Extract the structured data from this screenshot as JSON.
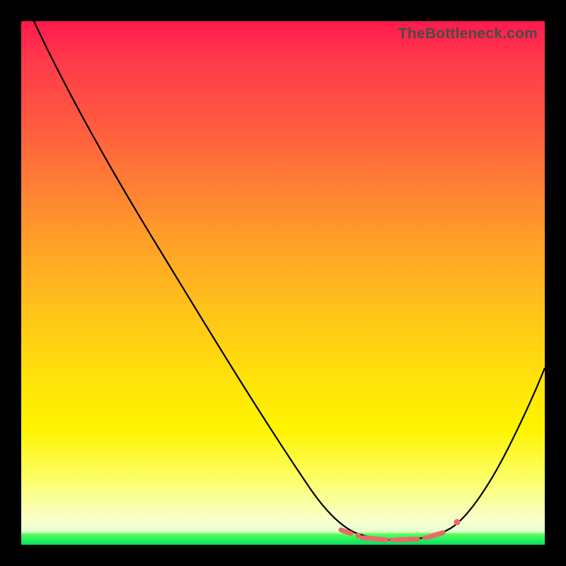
{
  "watermark": "TheBottleneck.com",
  "colors": {
    "frame": "#000000",
    "curve": "#000000",
    "markers": "#e86a6a",
    "gradient_top": "#ff1a4d",
    "gradient_bottom": "#00e060"
  },
  "chart_data": {
    "type": "line",
    "title": "",
    "xlabel": "",
    "ylabel": "",
    "xlim": [
      0,
      100
    ],
    "ylim": [
      0,
      100
    ],
    "x": [
      3,
      10,
      20,
      30,
      40,
      50,
      56,
      60,
      64,
      68,
      72,
      76,
      80,
      84,
      88,
      92,
      96,
      100
    ],
    "values": [
      100,
      88,
      72,
      56,
      40,
      24,
      12,
      6,
      2,
      0.5,
      0.2,
      0.3,
      1,
      3,
      8,
      16,
      26,
      38
    ],
    "valley_range_x": [
      60,
      84
    ],
    "markers_x": [
      60,
      63,
      66,
      69,
      72,
      75,
      78,
      81,
      84,
      86
    ]
  }
}
